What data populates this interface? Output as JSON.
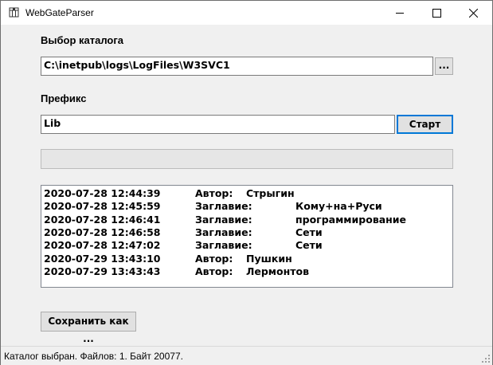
{
  "window": {
    "title": "WebGateParser"
  },
  "catalog": {
    "label": "Выбор каталога",
    "path": "C:\\inetpub\\logs\\LogFiles\\W3SVC1",
    "browse_label": "..."
  },
  "prefix": {
    "label": "Префикс",
    "value": "Lib",
    "start_label": "Старт"
  },
  "progress": {
    "value": 0
  },
  "log": [
    {
      "time": "2020-07-28 12:44:39",
      "key": "Автор:",
      "value": "Стрыгин"
    },
    {
      "time": "2020-07-28 12:45:59",
      "key": "Заглавие:",
      "value": "Кому+на+Руси"
    },
    {
      "time": "2020-07-28 12:46:41",
      "key": "Заглавие:",
      "value": "программирование"
    },
    {
      "time": "2020-07-28 12:46:58",
      "key": "Заглавие:",
      "value": "Сети"
    },
    {
      "time": "2020-07-28 12:47:02",
      "key": "Заглавие:",
      "value": "Сети"
    },
    {
      "time": "2020-07-29 13:43:10",
      "key": "Автор:",
      "value": "Пушкин"
    },
    {
      "time": "2020-07-29 13:43:43",
      "key": "Автор:",
      "value": "Лермонтов"
    }
  ],
  "save": {
    "label": "Сохранить как ..."
  },
  "status": {
    "text": "Каталог выбран. Файлов: 1. Байт 20077."
  }
}
